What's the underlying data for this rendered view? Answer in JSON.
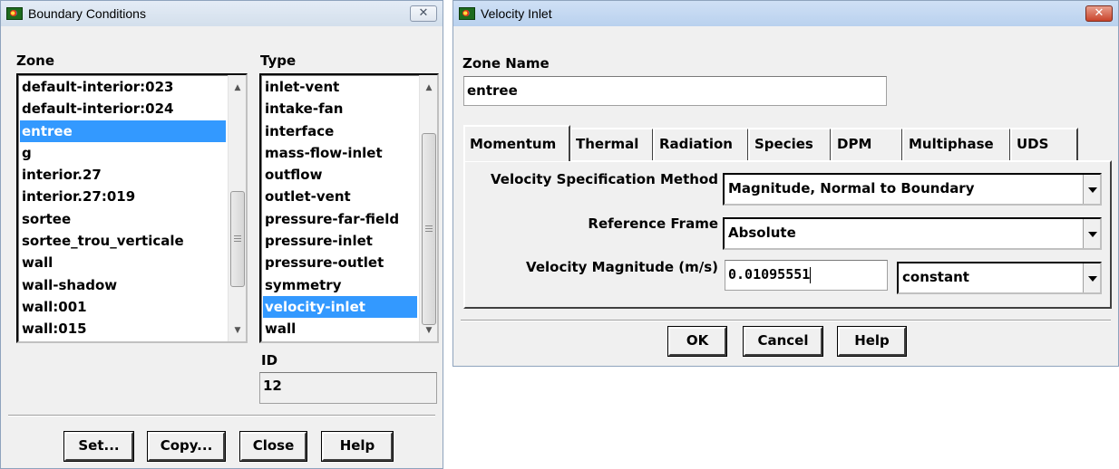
{
  "boundary_conditions": {
    "title": "Boundary Conditions",
    "zone_label": "Zone",
    "zones": [
      "default-interior:023",
      "default-interior:024",
      "entree",
      "g",
      "interior.27",
      "interior.27:019",
      "sortee",
      "sortee_trou_verticale",
      "wall",
      "wall-shadow",
      "wall:001",
      "wall:015"
    ],
    "selected_zone": "entree",
    "type_label": "Type",
    "types": [
      "inlet-vent",
      "intake-fan",
      "interface",
      "mass-flow-inlet",
      "outflow",
      "outlet-vent",
      "pressure-far-field",
      "pressure-inlet",
      "pressure-outlet",
      "symmetry",
      "velocity-inlet",
      "wall"
    ],
    "selected_type": "velocity-inlet",
    "id_label": "ID",
    "id_value": "12",
    "buttons": {
      "set": "Set...",
      "copy": "Copy...",
      "close": "Close",
      "help": "Help"
    }
  },
  "velocity_inlet": {
    "title": "Velocity Inlet",
    "zone_name_label": "Zone Name",
    "zone_name_value": "entree",
    "tabs": [
      "Momentum",
      "Thermal",
      "Radiation",
      "Species",
      "DPM",
      "Multiphase",
      "UDS"
    ],
    "active_tab": "Momentum",
    "velocity_spec_label": "Velocity Specification Method",
    "velocity_spec_value": "Magnitude, Normal to Boundary",
    "reference_frame_label": "Reference Frame",
    "reference_frame_value": "Absolute",
    "velocity_mag_label": "Velocity Magnitude (m/s)",
    "velocity_mag_value": "0.01095551",
    "velocity_mag_profile": "constant",
    "buttons": {
      "ok": "OK",
      "cancel": "Cancel",
      "help": "Help"
    }
  },
  "icons": {
    "app": "fluent-app-icon",
    "close": "close-icon"
  }
}
